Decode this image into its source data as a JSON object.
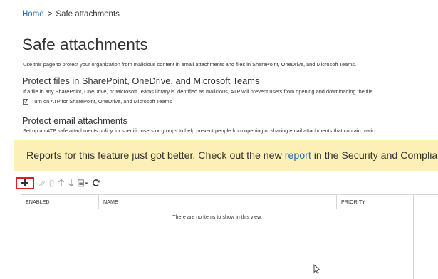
{
  "breadcrumb": {
    "home": "Home",
    "separator": ">",
    "current": "Safe attachments"
  },
  "page": {
    "title": "Safe attachments",
    "description": "Use this page to protect your organization from malicious content in email attachments and files in SharePoint, OneDrive, and Microsoft Teams."
  },
  "section_files": {
    "title": "Protect files in SharePoint, OneDrive, and Microsoft Teams",
    "description": "If a file in any SharePoint, OneDrive, or Microsoft Teams library is identified as malicious, ATP will prevent users from opening and downloading the file.",
    "checkbox_label": "Turn on ATP for SharePoint, OneDrive, and Microsoft Teams",
    "checkbox_checked": true
  },
  "section_email": {
    "title": "Protect email attachments",
    "description": "Set up an ATP safe attachments policy for specific users or groups to help prevent people from opening or sharing email attachments that contain malic"
  },
  "banner": {
    "text_before": "Reports for this feature just got better. Check out the new ",
    "link": "report",
    "text_after": " in the Security and Compliance Ce",
    "color": "#fdf0b7"
  },
  "toolbar": {
    "icons": [
      "plus-icon",
      "pencil-icon",
      "trash-icon",
      "arrow-up-icon",
      "arrow-down-icon",
      "export-icon",
      "refresh-icon"
    ]
  },
  "grid": {
    "columns": [
      "ENABLED",
      "NAME",
      "PRIORITY"
    ],
    "empty_message": "There are no items to show in this view."
  },
  "colors": {
    "link": "#2b6cb0",
    "highlight_border": "#d9201f"
  }
}
